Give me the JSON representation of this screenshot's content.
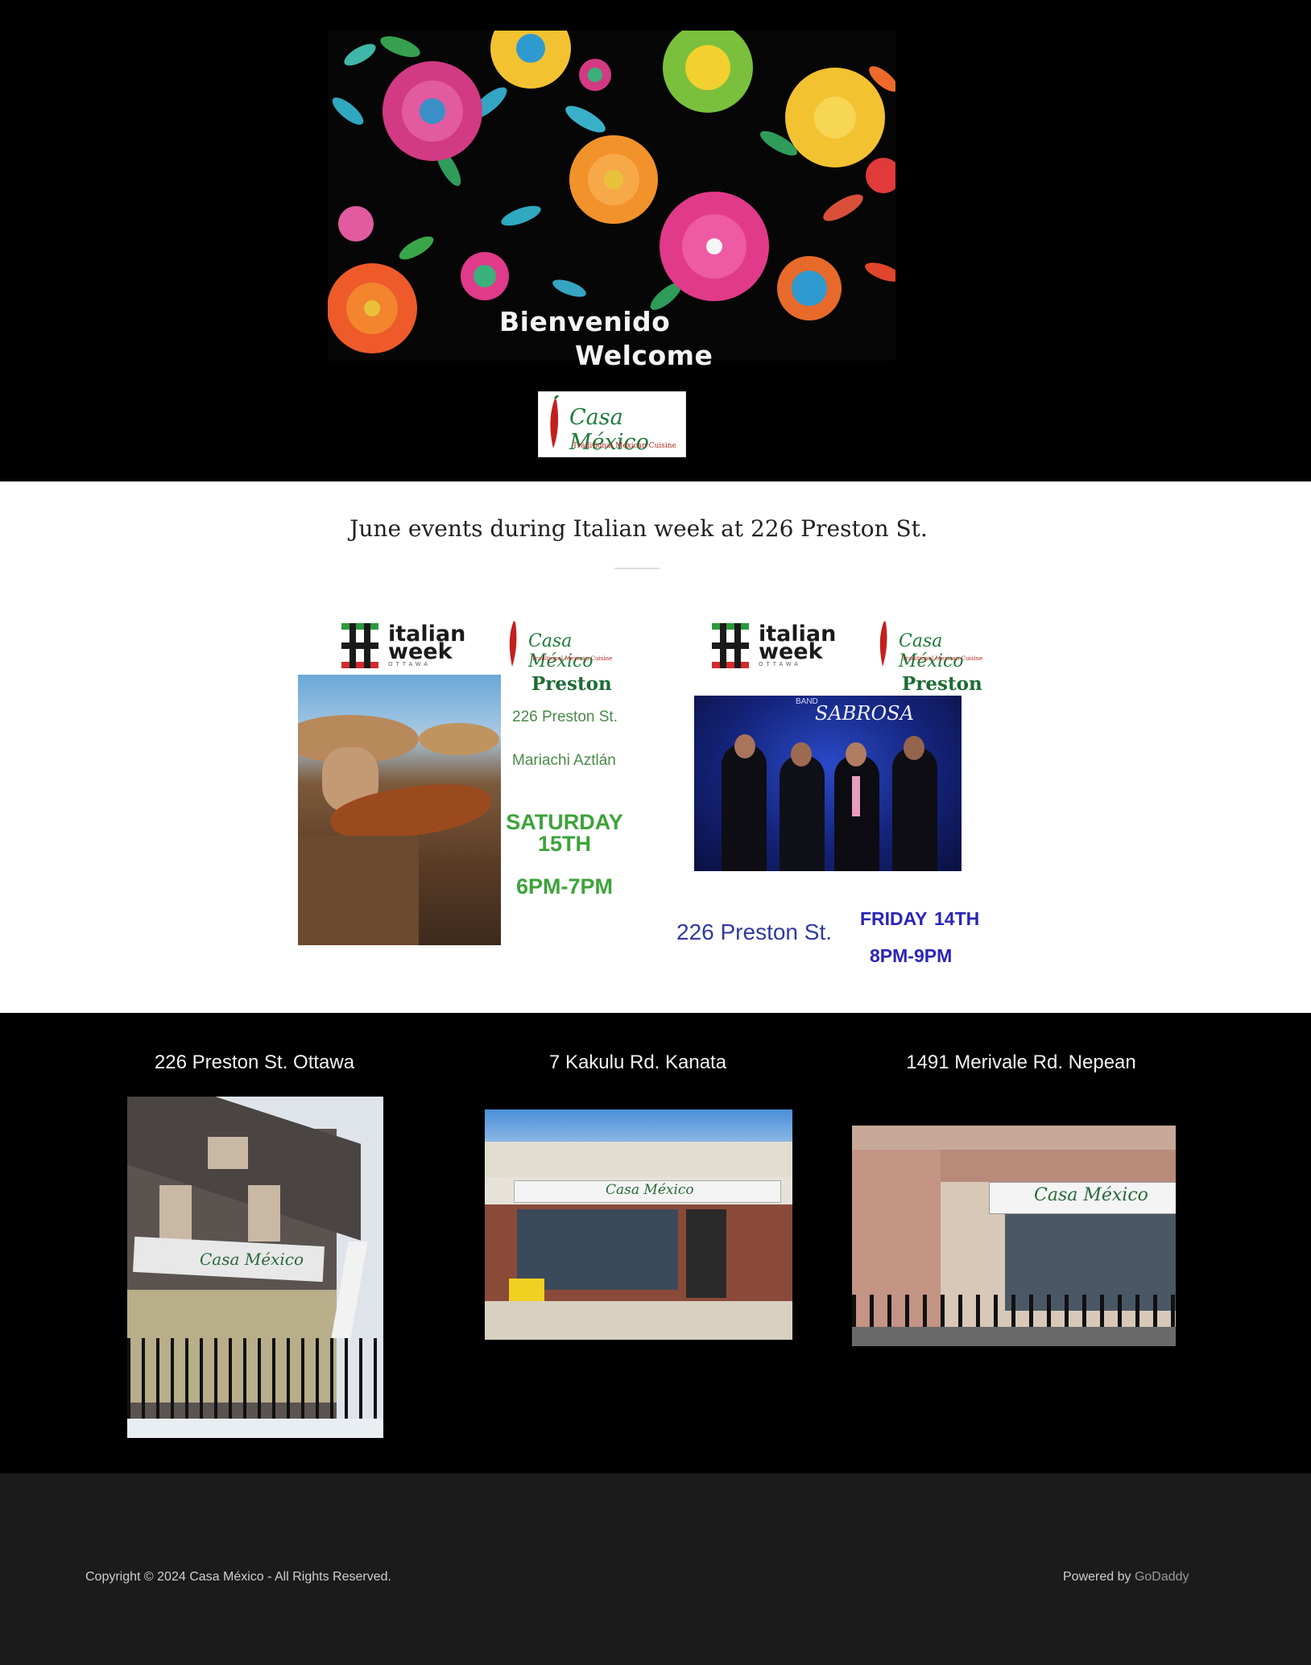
{
  "hero": {
    "greeting_es": "Bienvenido",
    "greeting_en": "Welcome",
    "logo_name": "Casa México",
    "logo_tagline": "Traditional Mexican Cuisine"
  },
  "events": {
    "title": "June events during Italian week at 226 Preston St.",
    "flyer1": {
      "italian_week_line1": "italian",
      "italian_week_line2": "week",
      "italian_week_sub": "OTTAWA",
      "logo_name": "Casa México",
      "logo_tagline": "Traditional Mexican Cuisine",
      "location": "Preston",
      "address": "226 Preston St.",
      "performer": "Mariachi Aztlán",
      "day": "SATURDAY",
      "date": "15TH",
      "time": "6PM-7PM"
    },
    "flyer2": {
      "italian_week_line1": "italian",
      "italian_week_line2": "week",
      "italian_week_sub": "OTTAWA",
      "logo_name": "Casa México",
      "logo_tagline": "Traditional Mexican Cuisine",
      "location": "Preston",
      "band_name": "SABROSA",
      "band_prefix": "BAND",
      "address": "226 Preston St.",
      "day": "FRIDAY",
      "date": "14TH",
      "time": "8PM-9PM"
    }
  },
  "locations": [
    {
      "title": "226 Preston St. Ottawa",
      "sign": "Casa México"
    },
    {
      "title": "7 Kakulu Rd. Kanata",
      "sign": "Casa México"
    },
    {
      "title": "1491 Merivale Rd. Nepean",
      "sign": "Casa México"
    }
  ],
  "footer": {
    "copyright": "Copyright © 2024 Casa México - All Rights Reserved.",
    "powered_prefix": "Powered by",
    "powered_brand": "GoDaddy"
  },
  "colors": {
    "hero_bg": "#000000",
    "events_bg": "#ffffff",
    "footer_bg": "#1b1b1b",
    "green": "#3da33a",
    "blue": "#2a25b8"
  }
}
